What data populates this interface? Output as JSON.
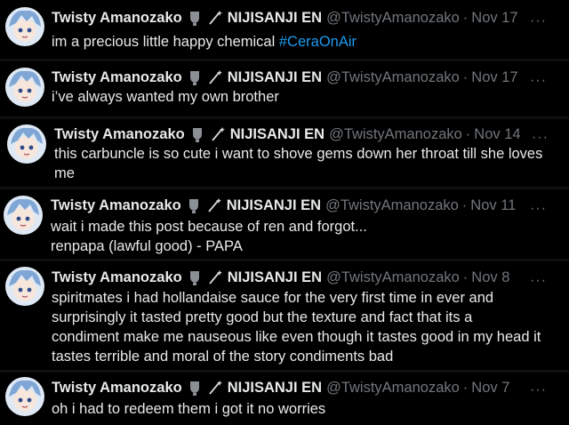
{
  "tweets": [
    {
      "name": "Twisty Amanozako",
      "affiliation": "NIJISANJI EN",
      "handle": "@TwistyAmanozako",
      "separator": "·",
      "date": "Nov 17",
      "more": "···",
      "text": "im a precious little happy chemical ",
      "hashtag": "#CeraOnAir"
    },
    {
      "name": "Twisty Amanozako",
      "affiliation": "NIJISANJI EN",
      "handle": "@TwistyAmanozako",
      "separator": "·",
      "date": "Nov 17",
      "more": "···",
      "text": "i’ve always wanted my own brother"
    },
    {
      "name": "Twisty Amanozako",
      "affiliation": "NIJISANJI EN",
      "handle": "@TwistyAmanozako",
      "separator": "·",
      "date": "Nov 14",
      "more": "···",
      "text": "this carbuncle is so cute i want to shove gems down her throat till she loves\nme"
    },
    {
      "name": "Twisty Amanozako",
      "affiliation": "NIJISANJI EN",
      "handle": "@TwistyAmanozako",
      "separator": "·",
      "date": "Nov 11",
      "more": "···",
      "text": "wait i made this post because of ren and forgot...\nrenpapa (lawful good) - PAPA"
    },
    {
      "name": "Twisty Amanozako",
      "affiliation": "NIJISANJI EN",
      "handle": "@TwistyAmanozako",
      "separator": "·",
      "date": "Nov 8",
      "more": "···",
      "text": "spiritmates i had hollandaise sauce for the very first time in ever and\nsurprisingly it tasted pretty good but the texture and fact that its a\ncondiment make me nauseous like even though it tastes good in my head it\ntastes terrible and moral of the story condiments bad"
    },
    {
      "name": "Twisty Amanozako",
      "affiliation": "NIJISANJI EN",
      "handle": "@TwistyAmanozako",
      "separator": "·",
      "date": "Nov 7",
      "more": "···",
      "text": "oh i had to redeem them i got it no worries"
    }
  ],
  "icons": {
    "avatar": "avatar-icon",
    "affiliation_badge": "gray-badge-icon",
    "wand": "wand-icon",
    "more": "more-icon"
  },
  "colors": {
    "background": "#000000",
    "text": "#e7e9ea",
    "secondary": "#71767b",
    "hashtag": "#1d9bf0"
  }
}
